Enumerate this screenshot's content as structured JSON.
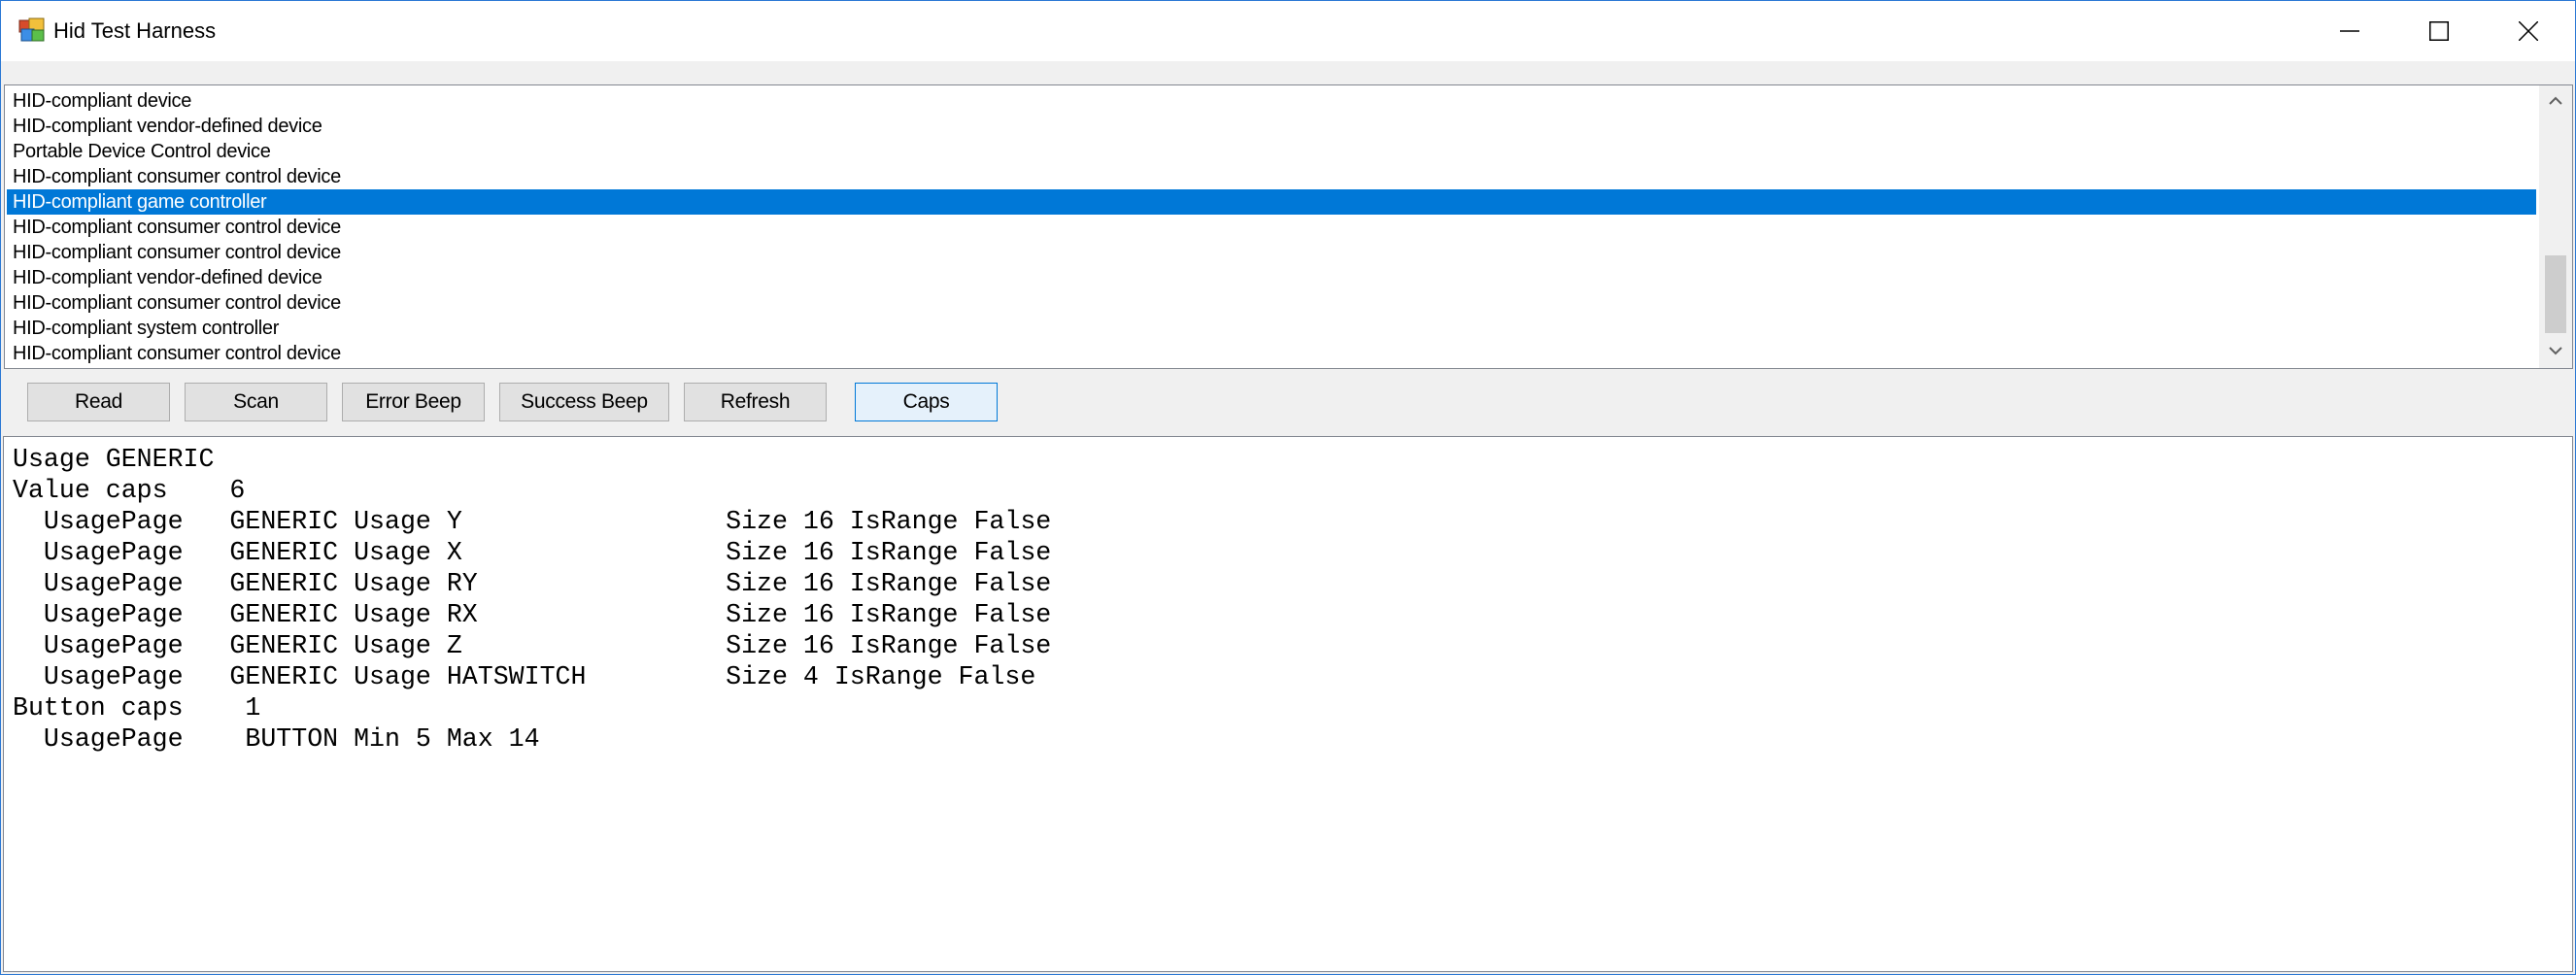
{
  "window": {
    "title": "Hid Test Harness",
    "icon": "app-icon"
  },
  "title_buttons": {
    "minimize": "minimize-icon",
    "maximize": "maximize-icon",
    "close": "close-icon"
  },
  "device_list": {
    "items": [
      "HID-compliant device",
      "HID-compliant vendor-defined device",
      "Portable Device Control device",
      "HID-compliant consumer control device",
      "HID-compliant game controller",
      "HID-compliant consumer control device",
      "HID-compliant consumer control device",
      "HID-compliant vendor-defined device",
      "HID-compliant consumer control device",
      "HID-compliant system controller",
      "HID-compliant consumer control device"
    ],
    "selected": "HID-compliant game controller"
  },
  "toolbar": {
    "read": "Read",
    "scan": "Scan",
    "error_beep": "Error Beep",
    "success_beep": "Success Beep",
    "refresh": "Refresh",
    "caps": "Caps"
  },
  "output": {
    "lines": [
      "Usage GENERIC",
      "Value caps    6",
      "  UsagePage   GENERIC Usage Y                 Size 16 IsRange False",
      "  UsagePage   GENERIC Usage X                 Size 16 IsRange False",
      "  UsagePage   GENERIC Usage RY                Size 16 IsRange False",
      "  UsagePage   GENERIC Usage RX                Size 16 IsRange False",
      "  UsagePage   GENERIC Usage Z                 Size 16 IsRange False",
      "  UsagePage   GENERIC Usage HATSWITCH         Size 4 IsRange False",
      "Button caps    1",
      "  UsagePage    BUTTON Min 5 Max 14"
    ]
  },
  "colors": {
    "selection": "#0078d7",
    "window_border": "#2b78d4",
    "button_face": "#e1e1e1",
    "focused_button": "#e5f1fb"
  }
}
